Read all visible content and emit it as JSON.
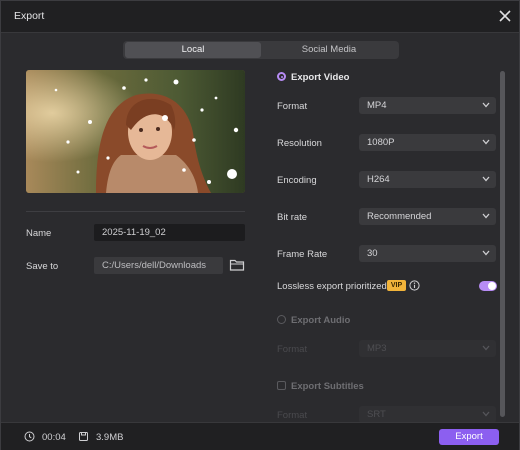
{
  "window": {
    "title": "Export"
  },
  "tabs": [
    {
      "label": "Local",
      "active": true
    },
    {
      "label": "Social Media",
      "active": false
    }
  ],
  "left": {
    "name_label": "Name",
    "name_value": "2025-11-19_02",
    "save_label": "Save to",
    "save_value": "C:/Users/dell/Downloads"
  },
  "export_video": {
    "label": "Export Video",
    "rows": [
      {
        "label": "Format",
        "value": "MP4"
      },
      {
        "label": "Resolution",
        "value": "1080P"
      },
      {
        "label": "Encoding",
        "value": "H264"
      },
      {
        "label": "Bit rate",
        "value": "Recommended"
      },
      {
        "label": "Frame Rate",
        "value": "30"
      }
    ],
    "lossless_label": "Lossless export prioritized",
    "vip_badge": "VIP",
    "lossless_on": true
  },
  "export_audio": {
    "label": "Export Audio",
    "format_label": "Format",
    "format_value": "MP3"
  },
  "export_subtitles": {
    "label": "Export Subtitles",
    "format_label": "Format",
    "format_value": "SRT"
  },
  "footer": {
    "duration": "00:04",
    "size": "3.9MB",
    "export_label": "Export"
  },
  "colors": {
    "accent": "#8c5ff0",
    "toggle": "#b78cf5",
    "vip": "#f2b43a"
  }
}
